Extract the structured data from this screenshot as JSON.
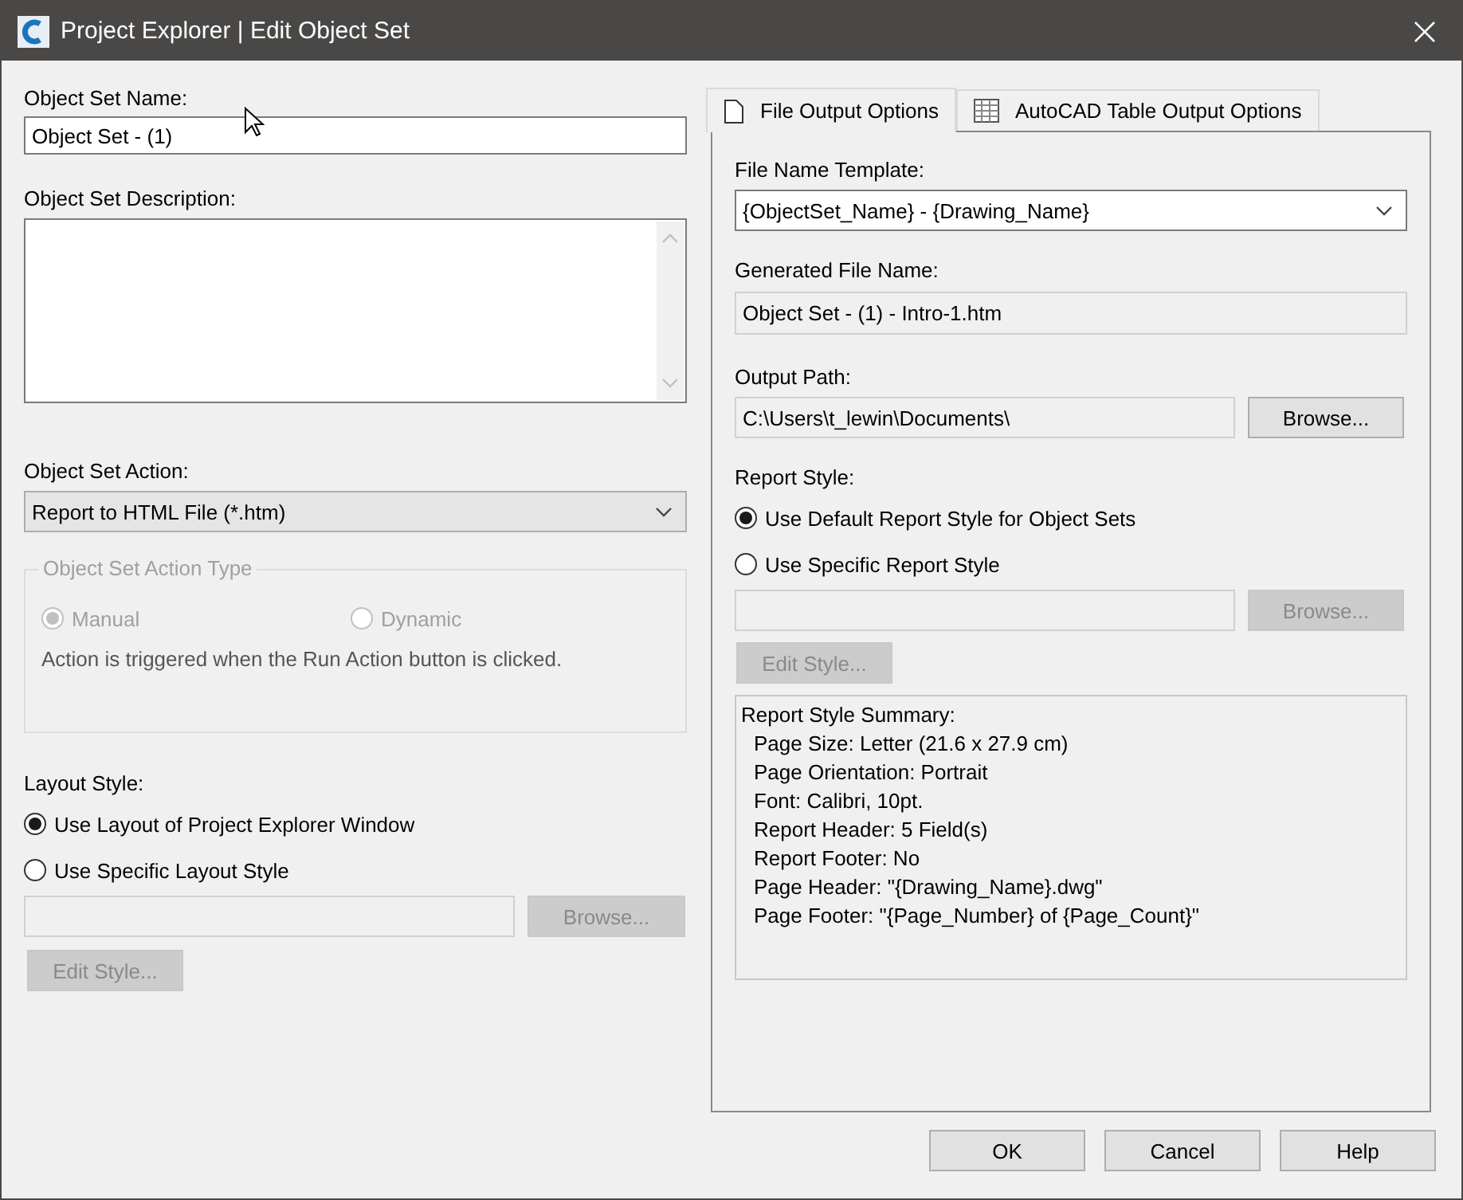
{
  "window": {
    "title": "Project Explorer | Edit Object Set"
  },
  "name_field": {
    "label": "Object Set Name:",
    "value": "Object Set - (1)"
  },
  "description_field": {
    "label": "Object Set Description:"
  },
  "action": {
    "label": "Object Set Action:",
    "value": "Report to HTML File (*.htm)"
  },
  "action_type": {
    "legend": "Object Set Action Type",
    "disabled": true,
    "options": [
      {
        "label": "Manual",
        "selected": true
      },
      {
        "label": "Dynamic",
        "selected": false
      }
    ],
    "note": "Action is triggered when the Run Action button is clicked."
  },
  "layout_style": {
    "label": "Layout Style:",
    "options": [
      {
        "label": "Use Layout of Project Explorer Window",
        "selected": true
      },
      {
        "label": "Use Specific Layout Style",
        "selected": false
      }
    ],
    "style_field": {
      "disabled": true
    },
    "browse_button": {
      "label": "Browse...",
      "disabled": true
    },
    "edit_button": {
      "label": "Edit Style...",
      "disabled": true
    }
  },
  "tabs": [
    {
      "label": "File Output Options",
      "selected": true
    },
    {
      "label": "AutoCAD Table Output Options",
      "selected": false
    }
  ],
  "file_output": {
    "template": {
      "label": "File Name Template:",
      "value": "{ObjectSet_Name} - {Drawing_Name}"
    },
    "generated": {
      "label": "Generated File Name:",
      "value": "Object Set - (1) - Intro-1.htm",
      "readonly": true
    },
    "output_path": {
      "label": "Output Path:",
      "value": "C:\\Users\\t_lewin\\Documents\\",
      "button": {
        "label": "Browse...",
        "disabled": false
      }
    },
    "report_style": {
      "label": "Report Style:",
      "options": [
        {
          "label": "Use Default Report Style for Object Sets",
          "selected": true
        },
        {
          "label": "Use Specific Report Style",
          "selected": false
        }
      ],
      "style_field": {
        "disabled": true
      },
      "browse_button": {
        "label": "Browse...",
        "disabled": true
      },
      "edit_button": {
        "label": "Edit Style...",
        "disabled": true
      },
      "summary": {
        "title": "Report Style Summary:",
        "lines": [
          "Page Size: Letter (21.6 x 27.9 cm)",
          "Page Orientation: Portrait",
          "Font: Calibri, 10pt.",
          "Report Header: 5 Field(s)",
          "Report Footer: No",
          "Page Header: \"{Drawing_Name}.dwg\"",
          "Page Footer: \"{Page_Number} of {Page_Count}\""
        ]
      }
    }
  },
  "buttons": [
    "OK",
    "Cancel",
    "Help"
  ]
}
